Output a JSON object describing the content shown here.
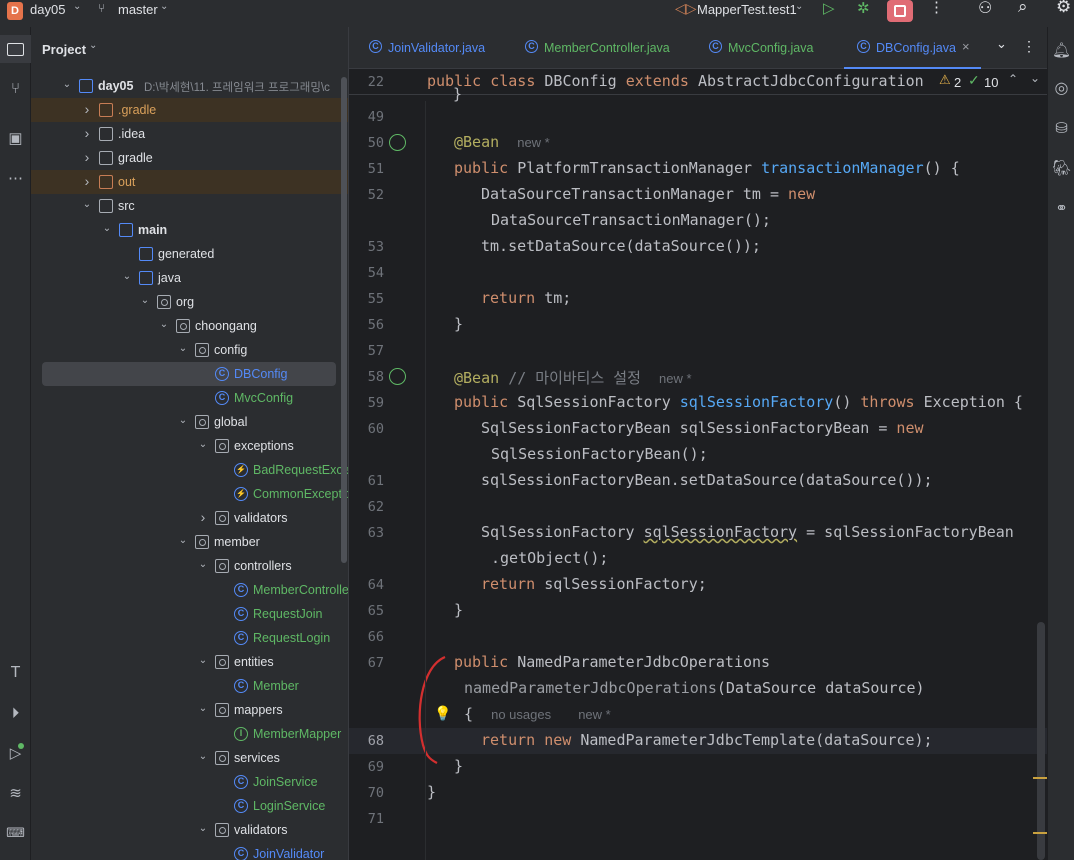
{
  "topbar": {
    "project_badge": "D",
    "project_name": "day05",
    "branch_name": "master",
    "run_config": "MapperTest.test1"
  },
  "project_panel": {
    "title": "Project",
    "tree": [
      {
        "label": "day05",
        "path": "D:\\박세현\\11. 프레임워크 프로그래밍\\c",
        "bold": true
      },
      {
        "label": ".gradle"
      },
      {
        "label": ".idea"
      },
      {
        "label": "gradle"
      },
      {
        "label": "out"
      },
      {
        "label": "src"
      },
      {
        "label": "main",
        "bold": true
      },
      {
        "label": "generated"
      },
      {
        "label": "java"
      },
      {
        "label": "org"
      },
      {
        "label": "choongang"
      },
      {
        "label": "config"
      },
      {
        "label": "DBConfig"
      },
      {
        "label": "MvcConfig"
      },
      {
        "label": "global"
      },
      {
        "label": "exceptions"
      },
      {
        "label": "BadRequestException"
      },
      {
        "label": "CommonException"
      },
      {
        "label": "validators"
      },
      {
        "label": "member"
      },
      {
        "label": "controllers"
      },
      {
        "label": "MemberController"
      },
      {
        "label": "RequestJoin"
      },
      {
        "label": "RequestLogin"
      },
      {
        "label": "entities"
      },
      {
        "label": "Member"
      },
      {
        "label": "mappers"
      },
      {
        "label": "MemberMapper"
      },
      {
        "label": "services"
      },
      {
        "label": "JoinService"
      },
      {
        "label": "LoginService"
      },
      {
        "label": "validators"
      },
      {
        "label": "JoinValidator"
      }
    ]
  },
  "editor": {
    "tabs": [
      {
        "label": "JoinValidator.java"
      },
      {
        "label": "MemberController.java"
      },
      {
        "label": "MvcConfig.java"
      },
      {
        "label": "DBConfig.java",
        "active": true
      }
    ],
    "sticky_line_number": "22",
    "sticky_header": {
      "t1": "public",
      "t2": "class",
      "t3": "DBConfig",
      "t4": "extends",
      "t5": "AbstractJdbcConfiguration"
    },
    "warnings_count": "2",
    "checks_count": "10",
    "lines": {
      "l49": {
        "num": "49"
      },
      "l50": {
        "num": "50",
        "t1": "@Bean",
        "hint": "new *"
      },
      "l51": {
        "num": "51",
        "t1": "public",
        "t2": "PlatformTransactionManager",
        "t3": "transactionManager",
        "t4": "() {"
      },
      "l52": {
        "num": "52",
        "t1": "DataSourceTransactionManager tm = ",
        "t2": "new"
      },
      "l52b": {
        "t1": "DataSourceTransactionManager();"
      },
      "l53": {
        "num": "53",
        "t1": "tm.setDataSource(dataSource());"
      },
      "l54": {
        "num": "54"
      },
      "l55": {
        "num": "55",
        "t1": "return",
        "t2": " tm;"
      },
      "l56": {
        "num": "56",
        "t1": "}"
      },
      "l57": {
        "num": "57"
      },
      "l58": {
        "num": "58",
        "t1": "@Bean",
        "t2": "// 마이바티스 설정",
        "hint": "new *"
      },
      "l59": {
        "num": "59",
        "t1": "public",
        "t2": "SqlSessionFactory",
        "t3": "sqlSessionFactory",
        "t4": "()",
        "t5": "throws",
        "t6": "Exception {"
      },
      "l60": {
        "num": "60",
        "t1": "SqlSessionFactoryBean sqlSessionFactoryBean = ",
        "t2": "new"
      },
      "l60b": {
        "t1": "SqlSessionFactoryBean();"
      },
      "l61": {
        "num": "61",
        "t1": "sqlSessionFactoryBean.setDataSource(dataSource());"
      },
      "l62": {
        "num": "62"
      },
      "l63": {
        "num": "63",
        "t1": "SqlSessionFactory ",
        "t2": "sqlSessionFactory",
        "t3": " = sqlSessionFactoryBean"
      },
      "l63b": {
        "t1": ".getObject();"
      },
      "l64": {
        "num": "64",
        "t1": "return",
        "t2": " sqlSessionFactory;"
      },
      "l65": {
        "num": "65",
        "t1": "}"
      },
      "l66": {
        "num": "66"
      },
      "l67": {
        "num": "67",
        "t1": "public",
        "t2": "NamedParameterJdbcOperations"
      },
      "l67b": {
        "t1": "namedParameterJdbcOperations",
        "t2": "(DataSource dataSource)"
      },
      "l67c": {
        "t1": "{",
        "hint1": "no usages",
        "hint2": "new *"
      },
      "l68": {
        "num": "68",
        "t1": "return",
        "t2": "new",
        "t3": "NamedParameterJdbcTemplate(dataSource);"
      },
      "l69": {
        "num": "69",
        "t1": "}"
      },
      "l70": {
        "num": "70",
        "t1": "}"
      },
      "l71": {
        "num": "71"
      }
    }
  },
  "colors": {
    "accent": "#548af7",
    "keyword": "#cf8e6d",
    "method": "#56a8f5",
    "annotation": "#b3ae60",
    "stop_button": "#e06c75",
    "annotation_circle": "#d32f2f"
  }
}
